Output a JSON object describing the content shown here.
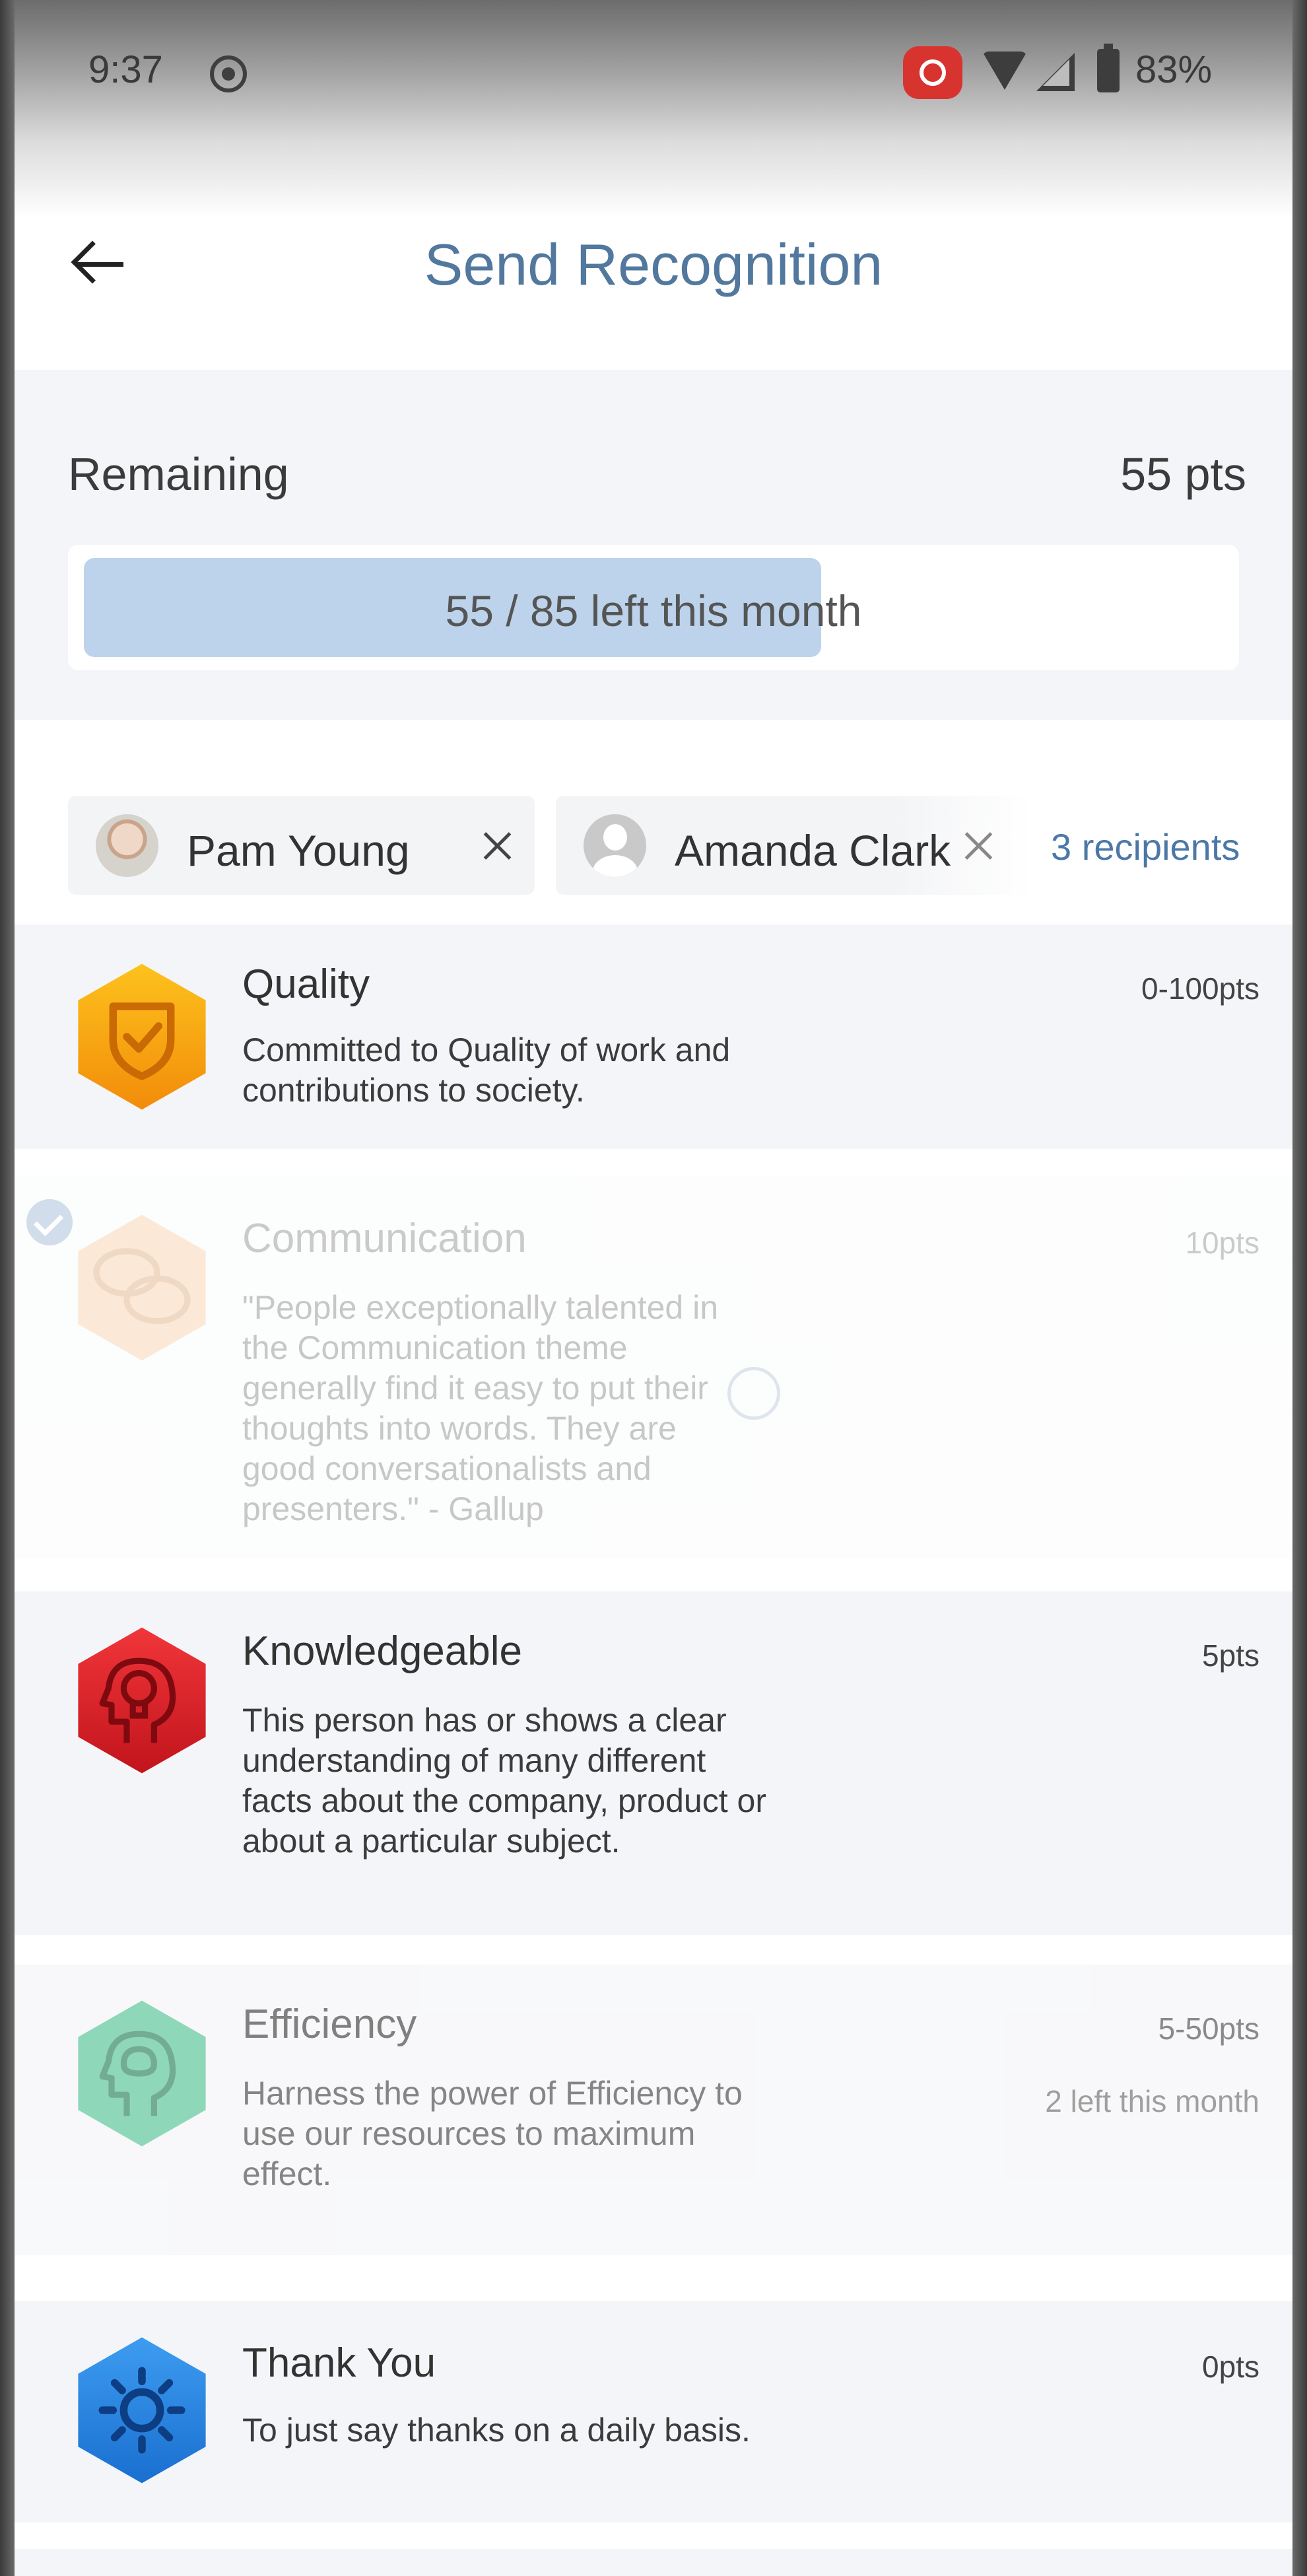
{
  "status_bar": {
    "time": "9:37",
    "battery": "83%",
    "icons": [
      "screen-record-icon",
      "cast-icon",
      "wifi-icon",
      "signal-icon",
      "battery-icon"
    ]
  },
  "header": {
    "title": "Send Recognition",
    "back_icon": "back-arrow-icon"
  },
  "remaining": {
    "label": "Remaining",
    "value": "55 pts",
    "progress_text": "55 / 85 left this month",
    "progress_fraction": 0.647
  },
  "recipients": {
    "chips": [
      {
        "name": "Pam Young"
      },
      {
        "name": "Amanda Clark"
      }
    ],
    "count_label": "3 recipients"
  },
  "recognitions": [
    {
      "title": "Quality",
      "description": "Committed to Quality of work and contributions to society.",
      "points": "0-100pts",
      "icon": "quality-shield-icon",
      "color": "#f5a20a"
    },
    {
      "title": "Communication",
      "description": "\"People exceptionally talented in the Communication theme generally find it easy to put their thoughts into words. They are good conversationalists and presenters.\" - Gallup",
      "points": "10pts",
      "icon": "speech-bubbles-icon",
      "color": "#f2b070"
    },
    {
      "title": "Knowledgeable",
      "description": "This person has or shows a clear understanding of many different facts about the company, product or about a particular subject.",
      "points": "5pts",
      "icon": "lightbulb-head-icon",
      "color": "#d9232a"
    },
    {
      "title": "Efficiency",
      "description": "Harness the power of Efficiency to use our resources to maximum effect.",
      "points": "5-50pts",
      "sub": "2 left this month",
      "icon": "brain-head-icon",
      "color": "#4cbf8f"
    },
    {
      "title": "Thank You",
      "description": "To just say thanks on a daily basis.",
      "points": "0pts",
      "icon": "sun-icon",
      "color": "#2b8ae6"
    }
  ]
}
